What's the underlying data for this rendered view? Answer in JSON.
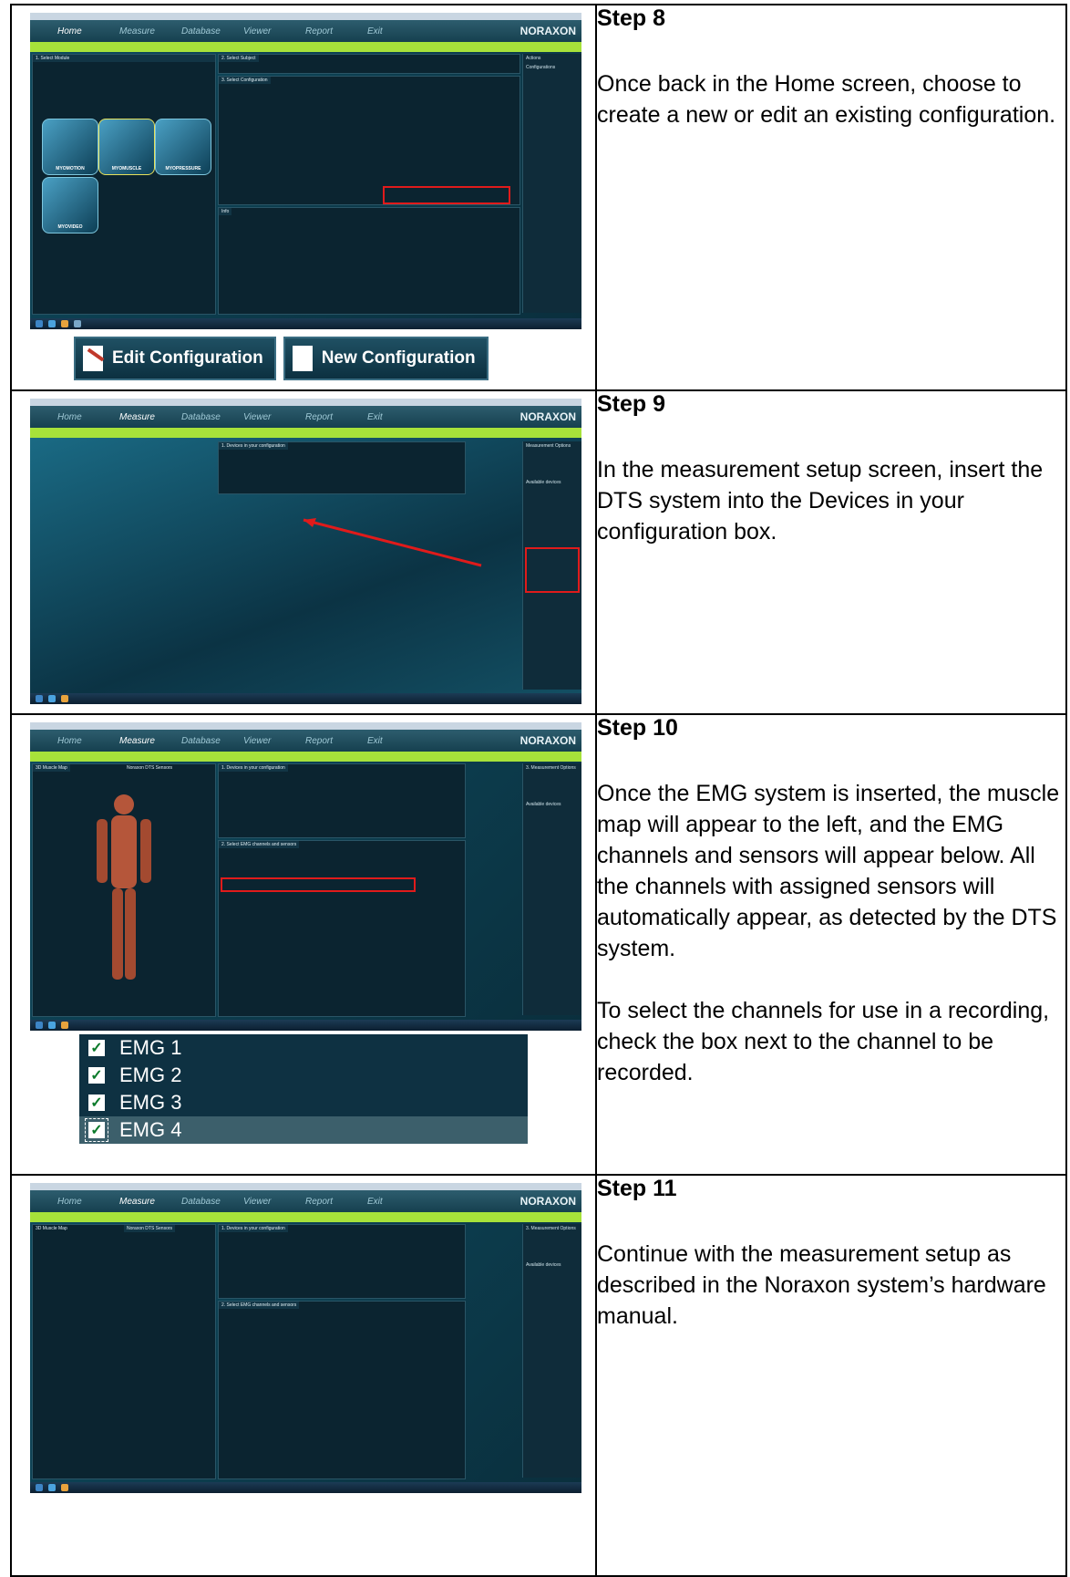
{
  "steps": [
    {
      "title": "Step 8",
      "paragraphs": [
        "Once back in the Home screen, choose to create a new or edit an existing configuration."
      ],
      "zoom_buttons": [
        "Edit Configuration",
        "New Configuration"
      ]
    },
    {
      "title": "Step 9",
      "paragraphs": [
        "In the measurement setup screen, insert the DTS system into the Devices in your configuration box."
      ]
    },
    {
      "title": "Step 10",
      "paragraphs": [
        "Once the EMG system is inserted, the muscle map will appear to the left, and the EMG channels and sensors will appear below. All the channels with assigned sensors will automatically appear, as detected by the DTS system.",
        "To select the channels for use in a recording, check the box next to the channel to be recorded."
      ],
      "channels": [
        "EMG 1",
        "EMG 2",
        "EMG 3",
        "EMG 4"
      ]
    },
    {
      "title": "Step 11",
      "paragraphs": [
        "Continue with the measurement setup as described in the Noraxon system’s hardware manual."
      ]
    }
  ],
  "app": {
    "brand": "NORAXON",
    "nav": [
      "Home",
      "Measure",
      "Database",
      "Viewer",
      "Report",
      "Exit"
    ],
    "step8": {
      "panels": [
        "1. Select Module",
        "2. Select Subject",
        "3. Select Configuration",
        "Actions",
        "Configurations",
        "Info"
      ],
      "modules": [
        "MYOMOTION",
        "MYOMUSCLE",
        "MYOPRESSURE",
        "MYOVIDEO"
      ],
      "buttons": [
        "Edit Configuration",
        "New Configuration"
      ]
    },
    "step9": {
      "panels": [
        "1. Devices in your configuration",
        "Measurement Options",
        "Available devices"
      ]
    },
    "step10": {
      "tabs": [
        "3D Muscle Map",
        "Noraxon DTS Sensors"
      ],
      "panels": [
        "1. Devices in your configuration",
        "2. Select EMG channels and sensors",
        "3. Measurement Options",
        "Available devices"
      ]
    },
    "step11": {
      "tabs": [
        "3D Muscle Map",
        "Noraxon DTS Sensors"
      ],
      "panels": [
        "1. Devices in your configuration",
        "2. Select EMG channels and sensors",
        "3. Measurement Options",
        "Available devices"
      ]
    }
  }
}
